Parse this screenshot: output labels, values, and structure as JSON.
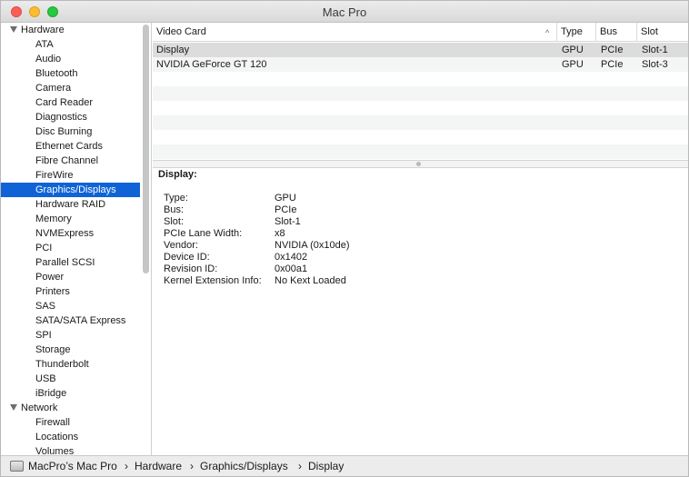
{
  "window": {
    "title": "Mac Pro"
  },
  "sidebar": {
    "groups": [
      {
        "label": "Hardware",
        "items": [
          "ATA",
          "Audio",
          "Bluetooth",
          "Camera",
          "Card Reader",
          "Diagnostics",
          "Disc Burning",
          "Ethernet Cards",
          "Fibre Channel",
          "FireWire",
          "Graphics/Displays",
          "Hardware RAID",
          "Memory",
          "NVMExpress",
          "PCI",
          "Parallel SCSI",
          "Power",
          "Printers",
          "SAS",
          "SATA/SATA Express",
          "SPI",
          "Storage",
          "Thunderbolt",
          "USB",
          "iBridge"
        ]
      },
      {
        "label": "Network",
        "items": [
          "Firewall",
          "Locations",
          "Volumes"
        ]
      }
    ],
    "selected": "Graphics/Displays"
  },
  "table": {
    "columns": [
      "Video Card",
      "Type",
      "Bus",
      "Slot"
    ],
    "rows": [
      [
        "Display",
        "GPU",
        "PCIe",
        "Slot-1"
      ],
      [
        "NVIDIA GeForce GT 120",
        "GPU",
        "PCIe",
        "Slot-3"
      ]
    ],
    "selected_row": 0
  },
  "detail": {
    "title": "Display:",
    "fields": [
      [
        "Type:",
        "GPU"
      ],
      [
        "Bus:",
        "PCIe"
      ],
      [
        "Slot:",
        "Slot-1"
      ],
      [
        "PCIe Lane Width:",
        "x8"
      ],
      [
        "Vendor:",
        "NVIDIA (0x10de)"
      ],
      [
        "Device ID:",
        "0x1402"
      ],
      [
        "Revision ID:",
        "0x00a1"
      ],
      [
        "Kernel Extension Info:",
        "No Kext Loaded"
      ]
    ]
  },
  "breadcrumb": [
    "MacPro’s Mac Pro",
    "Hardware",
    "Graphics/Displays",
    "Display"
  ],
  "colors": {
    "selection": "#0f63d6",
    "close": "#fc5f57",
    "minimize": "#fdbc2e",
    "zoom": "#28c840"
  },
  "icons": {
    "breadcrumb_root": "computer-icon",
    "sort": "sort-ascending-icon",
    "disclosure": "disclosure-triangle-icon"
  }
}
